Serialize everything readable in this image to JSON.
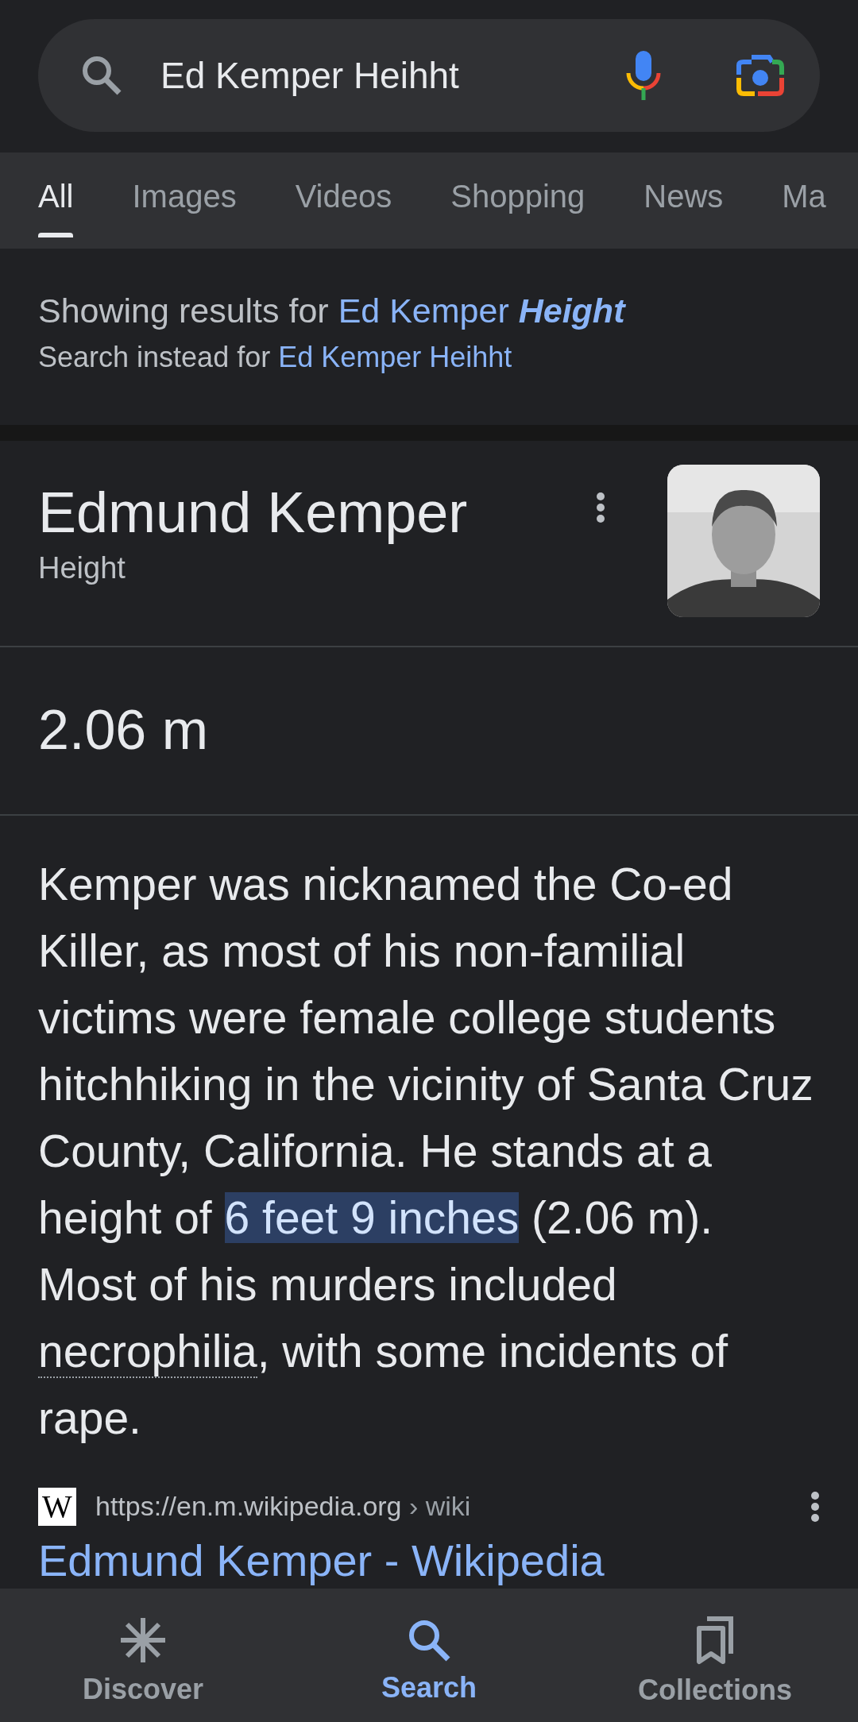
{
  "search": {
    "query": "Ed Kemper Heihht"
  },
  "tabs": [
    {
      "label": "All",
      "selected": true
    },
    {
      "label": "Images",
      "selected": false
    },
    {
      "label": "Videos",
      "selected": false
    },
    {
      "label": "Shopping",
      "selected": false
    },
    {
      "label": "News",
      "selected": false
    },
    {
      "label": "Ma",
      "selected": false
    }
  ],
  "spelling": {
    "showing_prefix": "Showing results for",
    "corrected_plain": "Ed Kemper",
    "corrected_emphasis": "Height",
    "instead_prefix": "Search instead for",
    "original_query": "Ed Kemper Heihht"
  },
  "answer_card": {
    "title": "Edmund Kemper",
    "subtitle": "Height",
    "value": "2.06 m",
    "description": [
      {
        "kind": "text",
        "text": "Kemper was nicknamed the Co-ed Killer, as most of his non-familial victims were female college students hitchhiking in the vicinity of Santa Cruz County, California. He stands at a height of "
      },
      {
        "kind": "highlight",
        "text": "6 feet 9 inches"
      },
      {
        "kind": "text",
        "text": " (2.06 m). Most of his murders included "
      },
      {
        "kind": "link",
        "text": "necrophilia"
      },
      {
        "kind": "text",
        "text": ", with some incidents of rape."
      }
    ]
  },
  "source": {
    "favicon": "W",
    "url": "https://en.m.wikipedia.org",
    "path": "› wiki",
    "title": "Edmund Kemper - Wikipedia"
  },
  "bottom_nav": [
    {
      "label": "Discover",
      "kind": "discover",
      "selected": false
    },
    {
      "label": "Search",
      "kind": "search",
      "selected": true
    },
    {
      "label": "Collections",
      "kind": "collections",
      "selected": false
    }
  ]
}
